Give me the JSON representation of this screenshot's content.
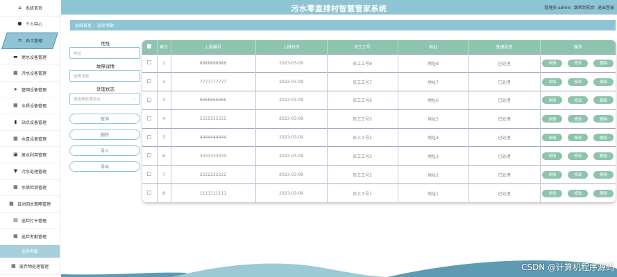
{
  "sidebar": {
    "items": [
      {
        "label": "系统首页",
        "icon": "home-icon",
        "glyph": "⌂"
      },
      {
        "label": "个人中心",
        "icon": "user-icon",
        "glyph": "●"
      },
      {
        "label": "员工管理",
        "icon": "list-icon",
        "glyph": "≡",
        "active": true
      },
      {
        "label": "尾水设备管理",
        "icon": "briefcase-icon",
        "glyph": "▬"
      },
      {
        "label": "污水设备管理",
        "icon": "grid-icon",
        "glyph": "▦"
      },
      {
        "label": "管网设备管理",
        "icon": "send-icon",
        "glyph": "➤"
      },
      {
        "label": "水质设备管理",
        "icon": "grid-icon",
        "glyph": "▦"
      },
      {
        "label": "站点设备管理",
        "icon": "chart-icon",
        "glyph": "▮"
      },
      {
        "label": "水泵设备管理",
        "icon": "grid-icon",
        "glyph": "▦"
      },
      {
        "label": "尾水利用管理",
        "icon": "clipboard-icon",
        "glyph": "▣"
      },
      {
        "label": "污水处理管理",
        "icon": "filter-icon",
        "glyph": "▼"
      },
      {
        "label": "水质检测管理",
        "icon": "grid-icon",
        "glyph": "▦"
      },
      {
        "label": "自动回水策略管理",
        "icon": "grid-icon",
        "glyph": "▦"
      },
      {
        "label": "巡检打卡管理",
        "icon": "checkin-icon",
        "glyph": "▤"
      },
      {
        "label": "巡检考勤管理",
        "icon": "grid-icon",
        "glyph": "▦"
      },
      {
        "label": "巡检考勤",
        "sub": true
      },
      {
        "label": "废弃物处理管理",
        "icon": "grid-icon",
        "glyph": "▦"
      }
    ]
  },
  "header": {
    "title": "污水零直排村智慧管家系统",
    "user_label": "管理员 admin",
    "front_link": "跳转到前台",
    "logout": "退出登录"
  },
  "breadcrumb": {
    "home": "系统首页",
    "sep": ":",
    "current": "巡检考勤"
  },
  "search": {
    "address_label": "地址",
    "address_placeholder": "地址",
    "fault_label": "故障详情",
    "fault_placeholder": "故障详情",
    "status_label": "处理状态",
    "status_placeholder": "请选择处理状态",
    "query_button": "查询",
    "delete_button": "删除",
    "import_button": "导入",
    "export_button": "导出"
  },
  "table": {
    "headers": [
      "索引",
      "上报编号",
      "上报时间",
      "员工工号",
      "地址",
      "处理状态",
      "操作"
    ],
    "actions": {
      "detail": "详情",
      "edit": "修改",
      "delete": "删除"
    },
    "rows": [
      {
        "index": "1",
        "report_no": "8888888888",
        "time": "2023-03-09",
        "emp": "员工工号8",
        "addr": "地址8",
        "status": "已处理"
      },
      {
        "index": "2",
        "report_no": "7777777777",
        "time": "2023-03-09",
        "emp": "员工工号7",
        "addr": "地址7",
        "status": "已处理"
      },
      {
        "index": "3",
        "report_no": "6666666666",
        "time": "2023-03-09",
        "emp": "员工工号6",
        "addr": "地址6",
        "status": "已处理"
      },
      {
        "index": "4",
        "report_no": "5555555555",
        "time": "2023-03-09",
        "emp": "员工工号5",
        "addr": "地址5",
        "status": "已处理"
      },
      {
        "index": "5",
        "report_no": "4444444444",
        "time": "2023-03-09",
        "emp": "员工工号4",
        "addr": "地址4",
        "status": "已处理"
      },
      {
        "index": "6",
        "report_no": "3333333333",
        "time": "2023-03-09",
        "emp": "员工工号3",
        "addr": "地址3",
        "status": "已处理"
      },
      {
        "index": "7",
        "report_no": "2222222222",
        "time": "2023-03-09",
        "emp": "员工工号2",
        "addr": "地址2",
        "status": "已处理"
      },
      {
        "index": "8",
        "report_no": "1111111111",
        "time": "2023-03-09",
        "emp": "员工工号1",
        "addr": "地址1",
        "status": "已处理"
      }
    ]
  },
  "watermark": "CSDN @计算机程序源码",
  "colors": {
    "primary": "#8ec4d4",
    "table_header": "#8ec4ad",
    "wave_dark": "#5e9bb3",
    "wave_light": "#9cc9d6"
  }
}
